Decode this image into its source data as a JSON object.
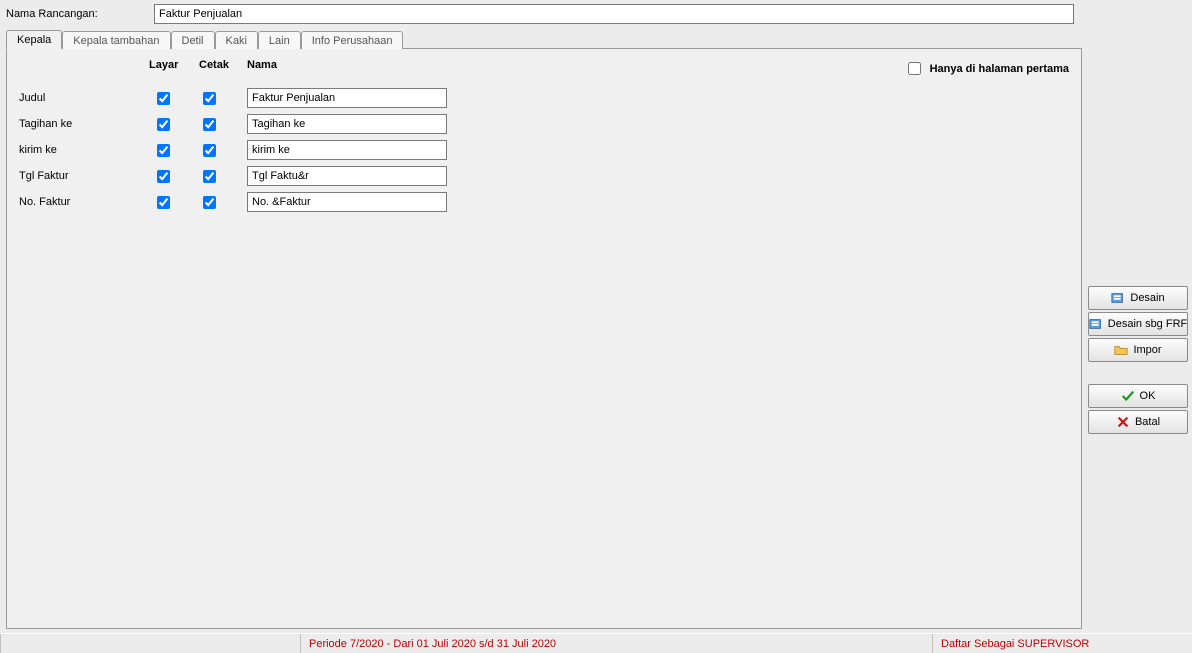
{
  "top": {
    "nama_rancangan_label": "Nama Rancangan:",
    "nama_rancangan_value": "Faktur Penjualan"
  },
  "tabs": {
    "kepala": "Kepala",
    "kepala_tambahan": "Kepala tambahan",
    "detil": "Detil",
    "kaki": "Kaki",
    "lain": "Lain",
    "info_perusahaan": "Info Perusahaan"
  },
  "headers": {
    "layar": "Layar",
    "cetak": "Cetak",
    "nama": "Nama",
    "only_first": "Hanya di halaman pertama"
  },
  "rows": {
    "judul": {
      "label": "Judul",
      "value": "Faktur Penjualan"
    },
    "tagihan_ke": {
      "label": "Tagihan ke",
      "value": "Tagihan ke"
    },
    "kirim_ke": {
      "label": "kirim ke",
      "value": "kirim ke"
    },
    "tgl_faktur": {
      "label": "Tgl Faktur",
      "value": "Tgl Faktu&r"
    },
    "no_faktur": {
      "label": "No. Faktur",
      "value": "No. &Faktur"
    }
  },
  "buttons": {
    "desain": "Desain",
    "desain_sbg_frf": "Desain sbg FRF",
    "impor": "Impor",
    "ok": "OK",
    "batal": "Batal"
  },
  "status": {
    "periode": "Periode 7/2020 - Dari 01 Juli 2020 s/d 31 Juli 2020",
    "login": "Daftar Sebagai SUPERVISOR"
  }
}
